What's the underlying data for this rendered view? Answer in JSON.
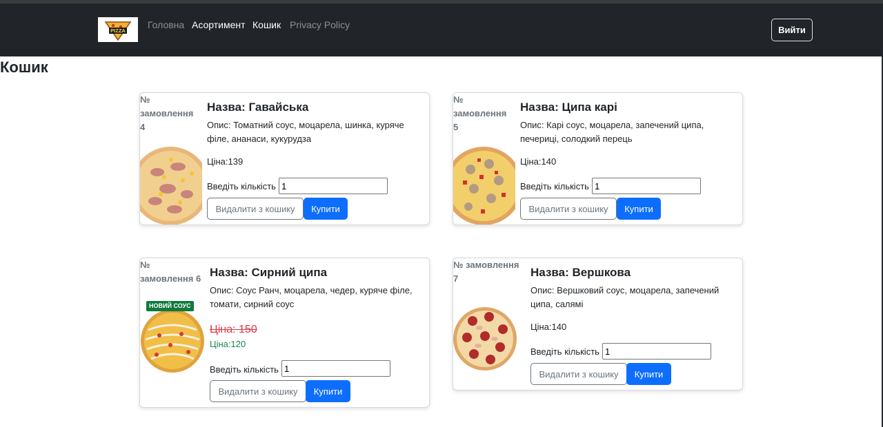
{
  "navbar": {
    "logo_text": "PIZZA",
    "links": [
      {
        "label": "Головна"
      },
      {
        "label": "Асортимент"
      },
      {
        "label": "Кошик"
      },
      {
        "label": "Privacy Policy"
      }
    ],
    "login_label": "Вийти"
  },
  "page": {
    "title": "Кошик"
  },
  "labels": {
    "qty": "Введіть кількість",
    "remove": "Видалити з кошику",
    "buy": "Купити"
  },
  "cards": [
    {
      "order_line1": "№",
      "order_line2": "замовлення",
      "order_line3": "4",
      "title": "Назва: Гавайська",
      "desc1": "Опис: Томатний соус, моцарела, шинка, куряче",
      "desc2": "філе, ананаси, кукурудза",
      "price": "Ціна:139",
      "qty": "1"
    },
    {
      "order_line1": "№",
      "order_line2": "замовлення",
      "order_line3": "5",
      "title": "Назва: Ципа карі",
      "desc1": "Опис: Карі соус, моцарела, запечений ципа,",
      "desc2": "печериці, солодкий перець",
      "price": "Ціна:140",
      "qty": "1"
    },
    {
      "order_line1": "№",
      "order_line2": "замовлення 6",
      "badge": "НОВИЙ СОУС",
      "title": "Назва: Сирний ципа",
      "desc1": "Опис: Соус Ранч, моцарела, чедер, куряче філе,",
      "desc2": "томати, сирний соус",
      "old_price": "Ціна: 150",
      "new_price": "Ціна:120",
      "qty": "1"
    },
    {
      "order_line1": "№ замовлення",
      "order_line2": "7",
      "title": "Назва: Вершкова",
      "desc1": "Опис: Вершковий соус, моцарела, запечений",
      "desc2": "ципа, салямі",
      "price": "Ціна:140",
      "qty": "1"
    }
  ],
  "colors": {
    "navbar": "#212529",
    "primary": "#0d6efd",
    "old_price": "#dc3545",
    "new_price": "#198754"
  }
}
